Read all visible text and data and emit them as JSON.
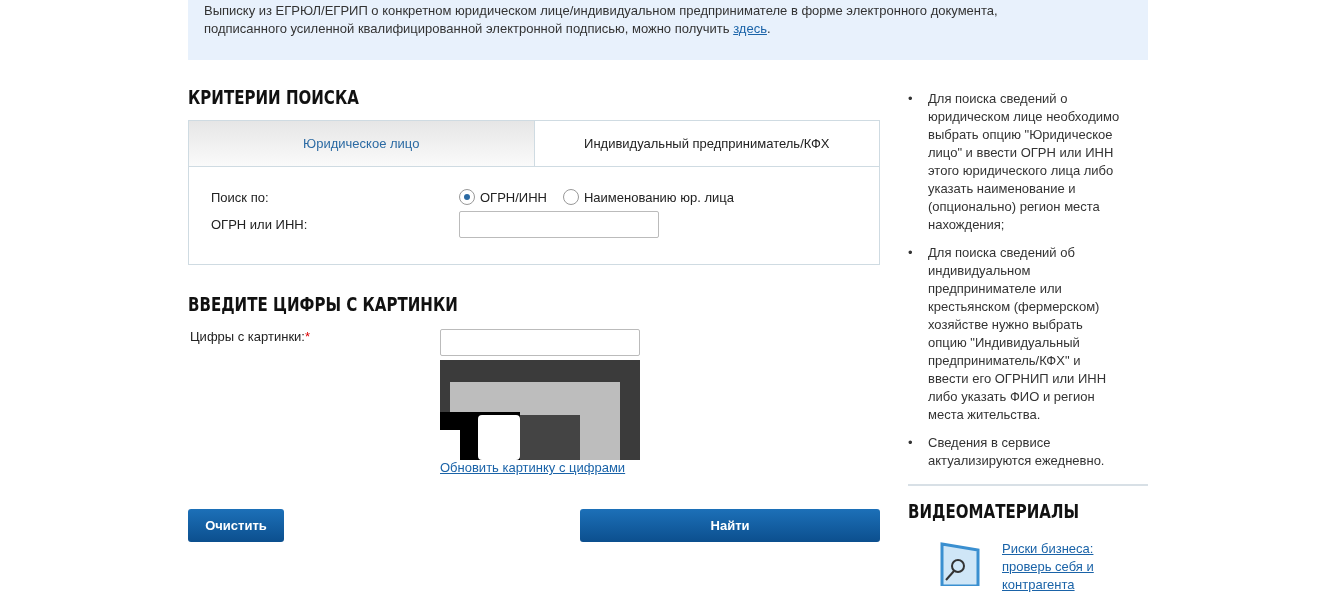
{
  "notice": {
    "lines": [
      "Выписку из ЕГРЮЛ/ЕГРИП о конкретном юридическом лице/индивидуальном предпринимателе в форме электронного документа,",
      "подписанного усиленной квалифицированной электронной подписью, можно получить"
    ],
    "link": "здесь",
    "tail": "."
  },
  "criteria": {
    "title": "КРИТЕРИИ ПОИСКА",
    "tabs": [
      {
        "label": "Юридическое лицо",
        "selected": true
      },
      {
        "label": "Индивидуальный предприниматель/КФХ",
        "selected": false
      }
    ],
    "search_by": {
      "label": "Поиск по:",
      "options": [
        {
          "label": "ОГРН/ИНН",
          "selected": true
        },
        {
          "label": "Наименованию юр. лица",
          "selected": false
        }
      ]
    },
    "field": {
      "label": "ОГРН или ИНН:"
    }
  },
  "captcha": {
    "title": "ВВЕДИТЕ ЦИФРЫ С КАРТИНКИ",
    "label": "Цифры с картинки:",
    "required": "*",
    "refresh": "Обновить картинку с цифрами"
  },
  "buttons": {
    "clear": "Очистить",
    "find": "Найти"
  },
  "help": [
    {
      "bullet": "•",
      "text": "Для поиска сведений о юридическом лице необходимо выбрать опцию \"Юридическое лицо\" и ввести ОГРН или ИНН этого юридического лица либо указать наименование и (опционально) регион места нахождения;"
    },
    {
      "bullet": "•",
      "text": "Для поиска сведений об индивидуальном предпринимателе или крестьянском (фермерском) хозяйстве нужно выбрать опцию \"Индивидуальный предприниматель/КФХ\" и ввести его ОГРНИП или ИНН либо указать ФИО и регион места жительства."
    },
    {
      "bullet": "•",
      "text": "Сведения в сервисе актуализируются ежедневно."
    }
  ],
  "videos": {
    "title": "ВИДЕОМАТЕРИАЛЫ",
    "items": [
      {
        "label": "Риски бизнеса: проверь себя и контрагента"
      }
    ]
  }
}
